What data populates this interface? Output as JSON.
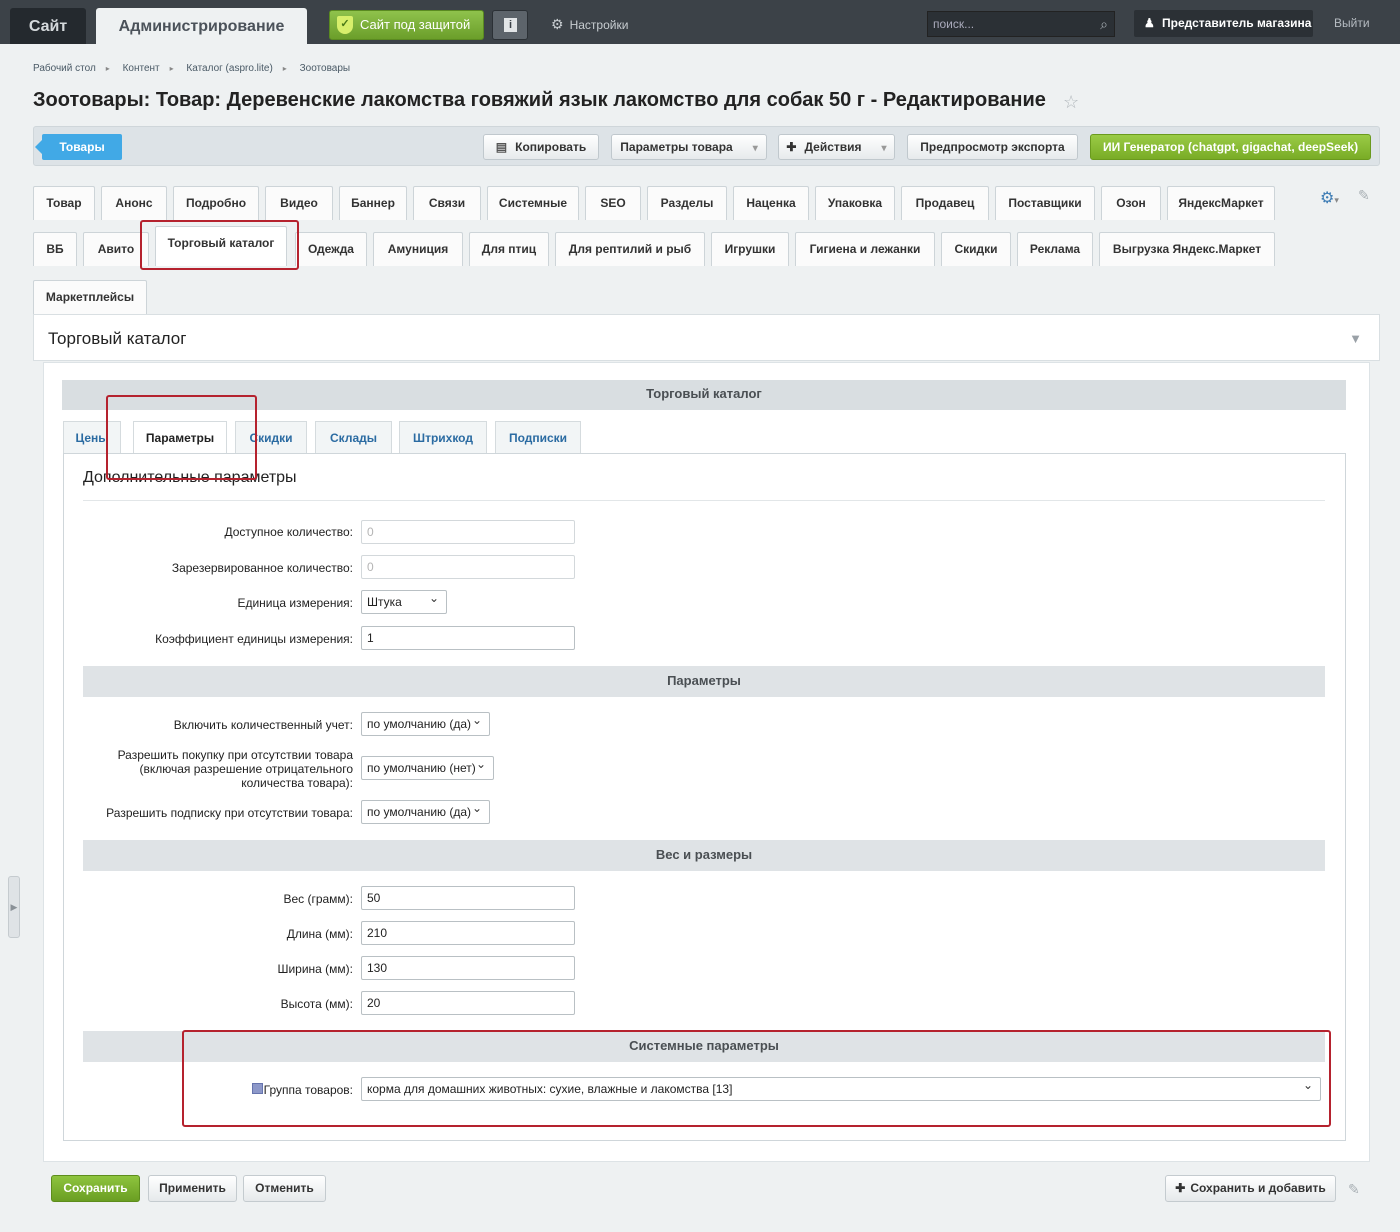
{
  "topbar": {
    "site_tab": "Сайт",
    "admin_tab": "Администрирование",
    "secure_label": "Сайт под защитой",
    "settings_label": "Настройки",
    "search_placeholder": "поиск...",
    "user_label": "Представитель магазина",
    "logout_label": "Выйти"
  },
  "breadcrumb": [
    "Рабочий стол",
    "Контент",
    "Каталог (aspro.lite)",
    "Зоотовары"
  ],
  "page_title": "Зоотовары: Товар: Деревенские лакомства говяжий язык лакомство для собак 50 г - Редактирование",
  "toolbar": {
    "goods": "Товары",
    "copy": "Копировать",
    "params": "Параметры товара",
    "actions": "Действия",
    "preview": "Предпросмотр экспорта",
    "ai": "ИИ Генератор (chatgpt, gigachat, deepSeek)"
  },
  "tabs_row1": [
    "Товар",
    "Анонс",
    "Подробно",
    "Видео",
    "Баннер",
    "Связи",
    "Системные",
    "SEO",
    "Разделы",
    "Наценка",
    "Упаковка",
    "Продавец",
    "Поставщики",
    "Озон",
    "ЯндексМаркет"
  ],
  "tabs_row2": [
    "ВБ",
    "Авито",
    "Торговый каталог",
    "Одежда",
    "Амуниция",
    "Для птиц",
    "Для рептилий и рыб",
    "Игрушки",
    "Гигиена и лежанки",
    "Скидки",
    "Реклама",
    "Выгрузка Яндекс.Маркет"
  ],
  "tabs_row3": [
    "Маркетплейсы"
  ],
  "section_title": "Торговый каталог",
  "inner_title": "Торговый каталог",
  "subtabs": [
    "Цены",
    "Параметры",
    "Скидки",
    "Склады",
    "Штрихкод",
    "Подписки"
  ],
  "form_heading": "Дополнительные параметры",
  "fields": {
    "available_label": "Доступное количество:",
    "available_value": "0",
    "reserved_label": "Зарезервированное количество:",
    "reserved_value": "0",
    "unit_label": "Единица измерения:",
    "unit_value": "Штука",
    "coef_label": "Коэффициент единицы измерения:",
    "coef_value": "1"
  },
  "group_params": "Параметры",
  "params": {
    "qty_label": "Включить количественный учет:",
    "qty_value": "по умолчанию (да)",
    "allow_label_1": "Разрешить покупку при отсутствии товара",
    "allow_label_2": "(включая разрешение отрицательного",
    "allow_label_3": "количества товара):",
    "allow_value": "по умолчанию (нет)",
    "subscribe_label": "Разрешить подписку при отсутствии товара:",
    "subscribe_value": "по умолчанию (да)"
  },
  "group_weight": "Вес и размеры",
  "weight": {
    "weight_label": "Вес (грамм):",
    "weight_value": "50",
    "length_label": "Длина (мм):",
    "length_value": "210",
    "width_label": "Ширина (мм):",
    "width_value": "130",
    "height_label": "Высота (мм):",
    "height_value": "20"
  },
  "group_system": "Системные параметры",
  "system": {
    "group_label": "Группа товаров:",
    "group_value": "корма для домашних животных: сухие, влажные и лакомства [13]"
  },
  "bottom": {
    "save": "Сохранить",
    "apply": "Применить",
    "cancel": "Отменить",
    "save_add": "Сохранить и добавить"
  },
  "colors": {
    "accent_green": "#79ac26",
    "accent_blue": "#41a9e6",
    "highlight_red": "#b5222e",
    "topbar": "#3c4248"
  }
}
